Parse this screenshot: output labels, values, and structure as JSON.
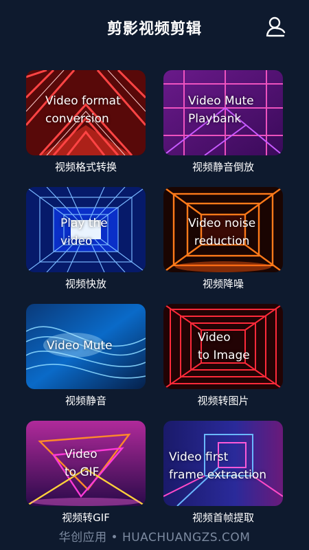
{
  "app": {
    "title": "剪影视频剪辑",
    "profile_icon": "user-icon"
  },
  "tools": [
    {
      "card_text": "Video format\nconversion",
      "label": "视频格式转换"
    },
    {
      "card_text": "Video Mute\nPlaybank",
      "label": "视频静音倒放"
    },
    {
      "card_text": "Play the\nvideo",
      "label": "视频快放"
    },
    {
      "card_text": "Video noise\nreduction",
      "label": "视频降噪"
    },
    {
      "card_text": "Video Mute",
      "label": "视频静音"
    },
    {
      "card_text": "Video\nto Image",
      "label": "视频转图片"
    },
    {
      "card_text": "Video\nto GIF",
      "label": "视频转GIF"
    },
    {
      "card_text": "Video first\nframe extraction",
      "label": "视频首帧提取"
    }
  ],
  "watermark": "华创应用 • HUACHUANGZS.COM",
  "colors": {
    "background": "#0e1a2e",
    "watermark": "#7c8aa0"
  }
}
